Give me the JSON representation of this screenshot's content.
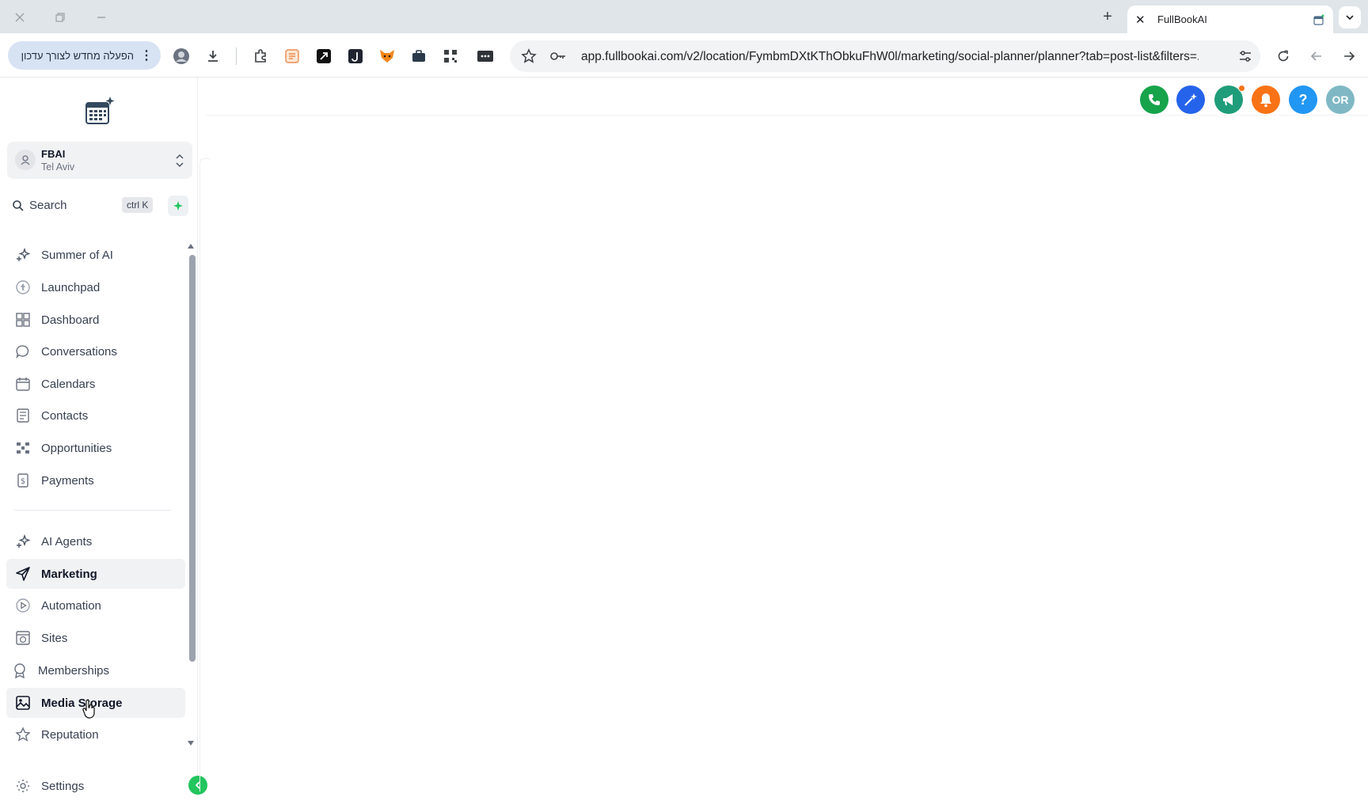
{
  "browser": {
    "tab_title": "FullBookAI",
    "new_tab_symbol": "+",
    "update_button_label": "הפעלה מחדש לצורך עדכון",
    "address_url": "app.fullbookai.com/v2/location/FymbmDXtKThObkuFhW0l/marketing/social-planner/planner?tab=post-list&filters=..."
  },
  "account": {
    "name": "FBAI",
    "location": "Tel Aviv"
  },
  "search": {
    "label": "Search",
    "shortcut": "ctrl K"
  },
  "nav": {
    "primary": [
      {
        "label": "Summer of AI",
        "icon": "sparkles-icon"
      },
      {
        "label": "Launchpad",
        "icon": "rocket-icon"
      },
      {
        "label": "Dashboard",
        "icon": "grid-icon"
      },
      {
        "label": "Conversations",
        "icon": "chat-bubble-icon"
      },
      {
        "label": "Calendars",
        "icon": "calendar-icon"
      },
      {
        "label": "Contacts",
        "icon": "address-book-icon"
      },
      {
        "label": "Opportunities",
        "icon": "pipeline-icon"
      },
      {
        "label": "Payments",
        "icon": "dollar-receipt-icon"
      }
    ],
    "secondary": [
      {
        "label": "AI Agents",
        "icon": "sparkles-icon"
      },
      {
        "label": "Marketing",
        "icon": "paper-plane-icon",
        "active": true
      },
      {
        "label": "Automation",
        "icon": "play-circle-icon"
      },
      {
        "label": "Sites",
        "icon": "globe-window-icon"
      },
      {
        "label": "Memberships",
        "icon": "badge-icon"
      },
      {
        "label": "Media Storage",
        "icon": "image-icon",
        "hover": true
      },
      {
        "label": "Reputation",
        "icon": "star-icon"
      }
    ],
    "settings_label": "Settings"
  },
  "header_actions": {
    "avatar_initials": "OR",
    "help_symbol": "?",
    "colors": {
      "phone": "#16a34a",
      "ai": "#2563eb",
      "announce": "#1f9d7a",
      "notifications": "#f97316",
      "help": "#2196f3",
      "avatar": "#7fb8c4"
    }
  }
}
